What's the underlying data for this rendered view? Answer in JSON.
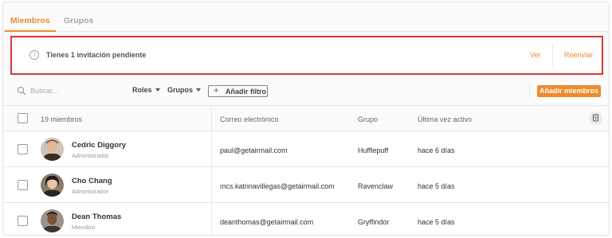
{
  "tabs": [
    {
      "label": "Miembros",
      "active": true
    },
    {
      "label": "Grupos",
      "active": false
    }
  ],
  "banner": {
    "icon": "info-icon",
    "icon_glyph": "i",
    "message": "Tienes 1 invitación pendiente",
    "view_label": "Ver",
    "resend_label": "Reenviar"
  },
  "toolbar": {
    "search_placeholder": "Buscar...",
    "roles_label": "Roles",
    "groups_label": "Grupos",
    "add_filter_label": "Añadir filtro",
    "add_filter_icon": "+",
    "add_members_label": "Añadir miembros"
  },
  "table": {
    "headers": {
      "members": "19 miembros",
      "email": "Correo electrónico",
      "group": "Grupo",
      "last_active": "Última vez activo"
    },
    "rows": [
      {
        "name": "Cedric Diggory",
        "role": "Administrador",
        "email": "paul@getairmail.com",
        "group": "Hufflepuff",
        "last_active": "hace 6 días"
      },
      {
        "name": "Cho Chang",
        "role": "Administrador",
        "email": "mcs.katrinavillegas@getairmail.com",
        "group": "Ravenclaw",
        "last_active": "hace 5 días"
      },
      {
        "name": "Dean Thomas",
        "role": "Miembro",
        "email": "deanthomas@getairmail.com",
        "group": "Gryffindor",
        "last_active": "hace 5 días"
      }
    ]
  },
  "colors": {
    "accent": "#ee8a2c",
    "highlight_border": "#d7383a"
  }
}
